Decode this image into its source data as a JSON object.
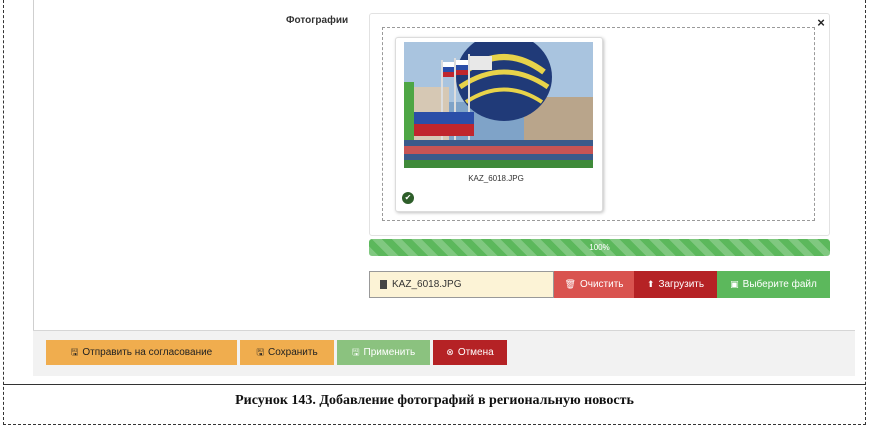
{
  "form": {
    "field_label": "Фотографии"
  },
  "uploader": {
    "close_glyph": "×",
    "file_name": "KAZ_6018.JPG",
    "progress_text": "100%",
    "progress_value": 1.0,
    "selected_file": "KAZ_6018.JPG",
    "clear_label": "Очистить",
    "upload_label": "Загрузить",
    "choose_label": "Выберите файл"
  },
  "footer": {
    "send_label": "Отправить на согласование",
    "save_label": "Сохранить",
    "apply_label": "Применить",
    "cancel_label": "Отмена"
  },
  "caption": "Рисунок 143. Добавление фотографий в региональную новость",
  "icons": {
    "file": "file-icon",
    "clear": "trash-icon",
    "upload": "upload-icon",
    "choose": "image-icon",
    "send": "floppy-icon",
    "save": "floppy-icon",
    "apply": "floppy-icon",
    "cancel": "cancel-icon",
    "status": "check-circle-icon"
  },
  "colors": {
    "success": "#5cb85c",
    "danger": "#d9534f",
    "danger_dark": "#b52225",
    "warning": "#f0ad4e",
    "file_field_bg": "#fcf3d6"
  }
}
